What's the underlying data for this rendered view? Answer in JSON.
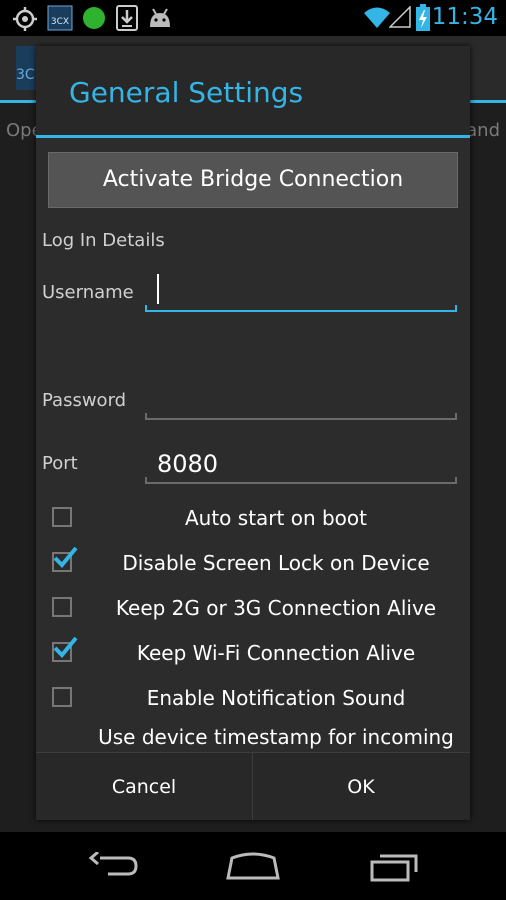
{
  "status_bar": {
    "time": "11:34",
    "left_icons": [
      "gps-icon",
      "3cx-app-icon",
      "green-dot-icon",
      "download-icon",
      "android-icon"
    ],
    "right_icons": [
      "wifi-icon",
      "signal-icon",
      "battery-charging-icon"
    ]
  },
  "background_app": {
    "logo_text": "3C",
    "left_text": "Ope",
    "right_text": "and"
  },
  "dialog": {
    "title": "General Settings",
    "bridge_button": "Activate Bridge Connection",
    "section_label": "Log In Details",
    "username_label": "Username",
    "username_value": "",
    "password_label": "Password",
    "password_value": "",
    "port_label": "Port",
    "port_value": "8080",
    "checkboxes": [
      {
        "label": "Auto start on boot",
        "checked": false
      },
      {
        "label": "Disable Screen Lock on Device",
        "checked": true
      },
      {
        "label": "Keep 2G or 3G Connection Alive",
        "checked": false
      },
      {
        "label": "Keep Wi-Fi Connection Alive",
        "checked": true
      },
      {
        "label": "Enable Notification Sound",
        "checked": false
      },
      {
        "label": "Use device timestamp for incoming SMS's (Uses local time and not operator time)",
        "checked": false
      }
    ],
    "cancel_label": "Cancel",
    "ok_label": "OK"
  },
  "colors": {
    "accent": "#33b5e5",
    "dialog_bg": "#282828",
    "button_bg": "#545454",
    "check": "#33b5e5"
  }
}
